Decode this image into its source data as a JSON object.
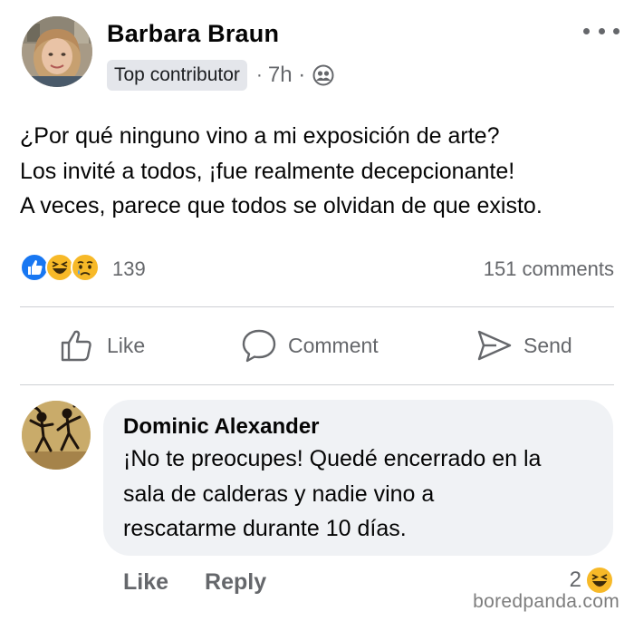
{
  "post": {
    "author": "Barbara Braun",
    "badge": "Top contributor",
    "separator": "·",
    "time": "7h ·",
    "audience_icon": "friends-icon",
    "text_lines": [
      "¿Por qué ninguno vino a mi exposición de arte?",
      "Los invité a todos, ¡fue realmente decepcionante!",
      "A veces, parece que todos se olvidan de que existo."
    ]
  },
  "reactions": {
    "icons": [
      "like-reaction-icon",
      "haha-reaction-icon",
      "sad-reaction-icon"
    ],
    "count": "139",
    "comments": "151 comments"
  },
  "actions": {
    "like": "Like",
    "comment": "Comment",
    "send": "Send"
  },
  "comment": {
    "author": "Dominic Alexander",
    "text_lines": [
      "¡No te preocupes! Quedé encerrado en la",
      "sala de calderas y nadie vino a",
      "rescatarme durante 10 días."
    ],
    "like": "Like",
    "reply": "Reply",
    "reaction_count": "2",
    "reaction_icon": "haha-reaction-icon"
  },
  "watermark": "boredpanda.com",
  "colors": {
    "like_blue": "#1877f2",
    "reaction_yellow": "#f7b928",
    "muted_text": "#65676b",
    "bubble_bg": "#f0f2f5"
  }
}
